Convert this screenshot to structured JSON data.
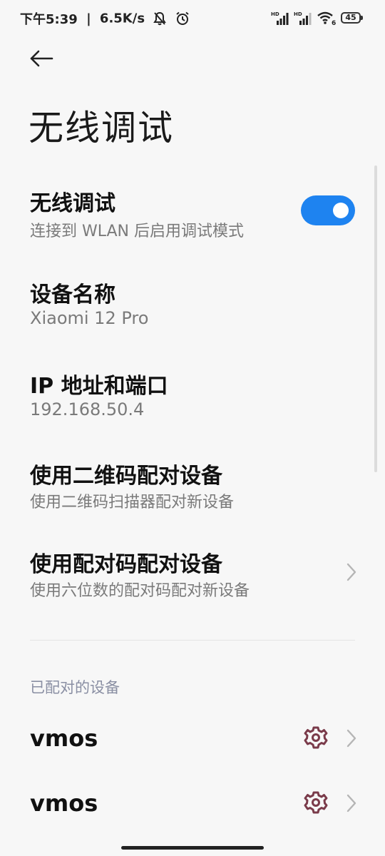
{
  "status_bar": {
    "time": "下午5:39",
    "separator": "|",
    "speed": "6.5K/s",
    "battery": "45",
    "sim1_tag": "HD",
    "sim2_tag": "HD",
    "wifi_tag": "6"
  },
  "page": {
    "title": "无线调试"
  },
  "settings": {
    "wireless_debugging": {
      "title": "无线调试",
      "subtitle": "连接到 WLAN 后启用调试模式",
      "enabled": true
    },
    "device_name": {
      "title": "设备名称",
      "value": "Xiaomi 12 Pro"
    },
    "ip_port": {
      "title": "IP 地址和端口",
      "value": "192.168.50.4"
    },
    "pair_qr": {
      "title": "使用二维码配对设备",
      "subtitle": "使用二维码扫描器配对新设备"
    },
    "pair_code": {
      "title": "使用配对码配对设备",
      "subtitle": "使用六位数的配对码配对新设备"
    }
  },
  "paired_devices": {
    "header": "已配对的设备",
    "items": [
      {
        "name": "vmos"
      },
      {
        "name": "vmos"
      }
    ]
  },
  "colors": {
    "accent": "#1e83f0",
    "gear": "#7a3b4a",
    "background": "#f7f7f7"
  }
}
